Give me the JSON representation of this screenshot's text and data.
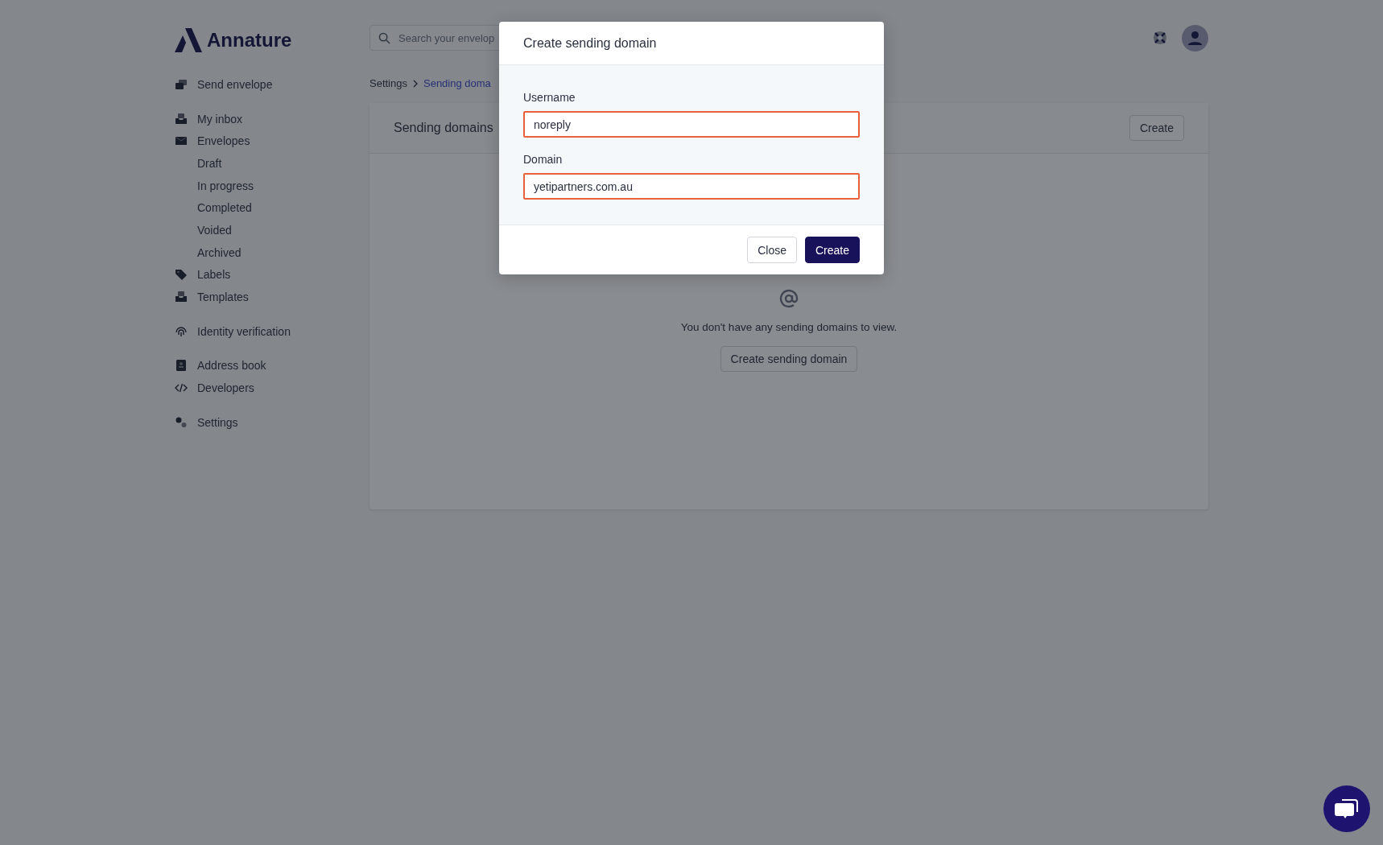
{
  "logo": {
    "name": "Annature"
  },
  "search": {
    "placeholder": "Search your envelop"
  },
  "sidebar": {
    "groups": [
      [
        {
          "label": "Send envelope"
        }
      ],
      [
        {
          "label": "My inbox"
        },
        {
          "label": "Envelopes",
          "children": [
            {
              "label": "Draft"
            },
            {
              "label": "In progress"
            },
            {
              "label": "Completed"
            },
            {
              "label": "Voided"
            },
            {
              "label": "Archived"
            }
          ]
        },
        {
          "label": "Labels"
        },
        {
          "label": "Templates"
        }
      ],
      [
        {
          "label": "Identity verification"
        }
      ],
      [
        {
          "label": "Address book"
        },
        {
          "label": "Developers"
        }
      ],
      [
        {
          "label": "Settings"
        }
      ]
    ]
  },
  "breadcrumb": [
    "Settings",
    "Sending doma"
  ],
  "card": {
    "title": "Sending domains",
    "button": "Create",
    "empty_message": "You don't have any sending domains to view.",
    "empty_button": "Create sending domain"
  },
  "modal": {
    "title": "Create sending domain",
    "fields": [
      {
        "label": "Username",
        "value": "noreply",
        "invalid": true
      },
      {
        "label": "Domain",
        "value": "yetipartners.com.au",
        "invalid": true
      }
    ],
    "buttons": [
      {
        "label": "Close",
        "kind": "secondary"
      },
      {
        "label": "Create",
        "kind": "primary"
      }
    ]
  }
}
